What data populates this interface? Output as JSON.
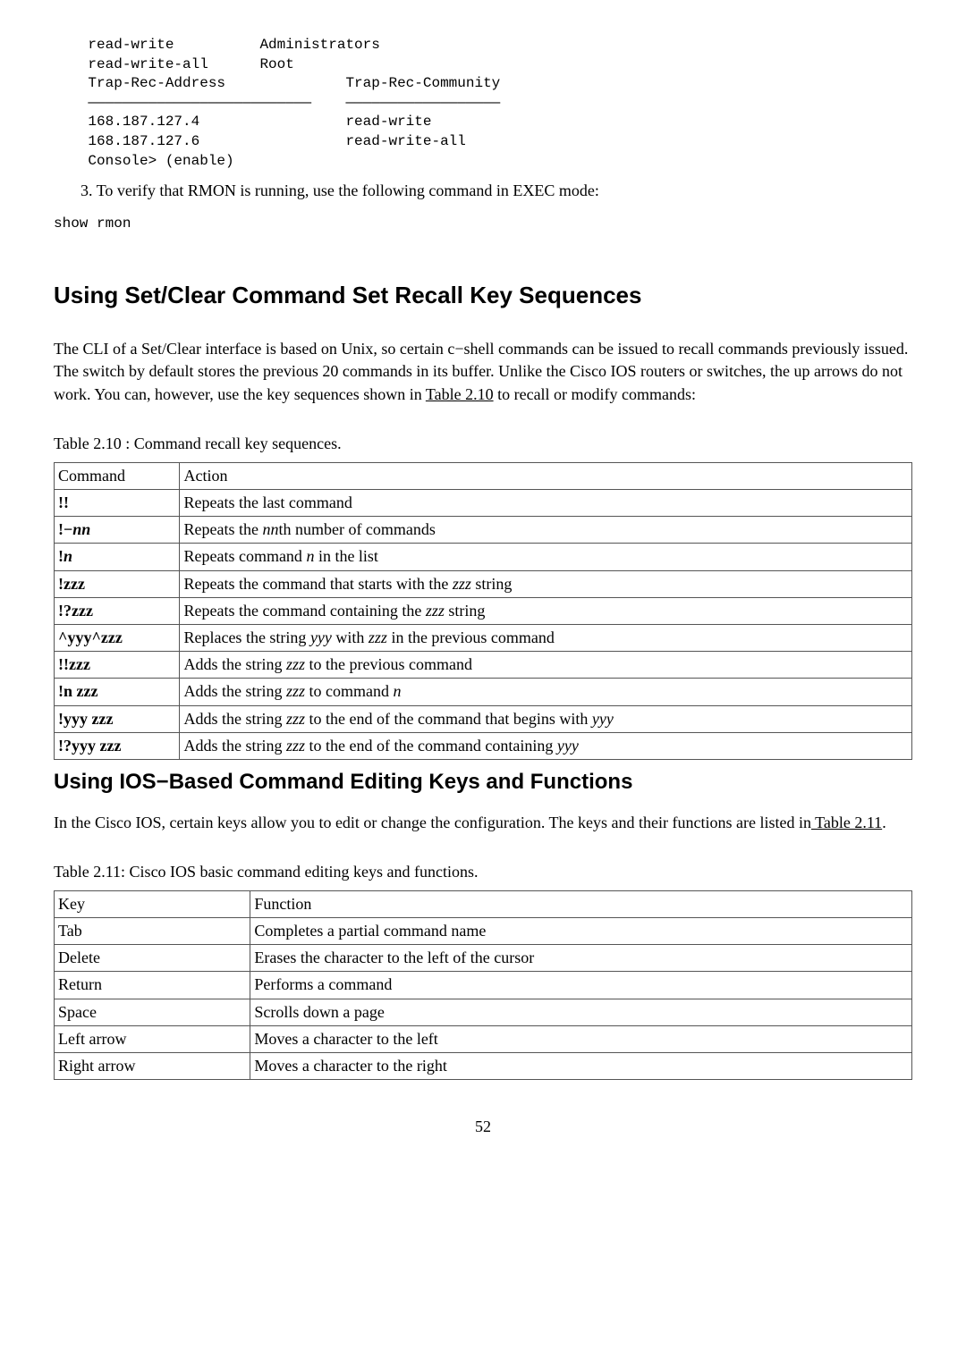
{
  "code_block_top": "    read-write          Administrators\n    read-write-all      Root\n    Trap-Rec-Address              Trap-Rec-Community\n    ——————————————————————————    ——————————————————\n    168.187.127.4                 read-write\n    168.187.127.6                 read-write-all\n    Console> (enable)",
  "list_item_3": "To verify that RMON is running, use the following command in EXEC mode:",
  "code_inline_show": "show rmon",
  "section1_title": "Using Set/Clear Command Set Recall Key Sequences",
  "section1_para_before": "The CLI of a Set/Clear interface is based on Unix, so certain c−shell commands can be issued to recall commands previously issued. The switch by default stores the previous 20 commands in its buffer. Unlike the Cisco IOS routers or switches, the up arrows do not work. You can, however, use the key sequences shown in ",
  "section1_para_link": "Table 2.10",
  "section1_para_after": " to recall or modify commands:",
  "table210_caption": "Table 2.10  : Command recall key sequences.",
  "table210": {
    "headers": [
      "Command",
      "Action"
    ],
    "rows": [
      {
        "cmd_plain": "!!",
        "action_plain": "Repeats the last command"
      },
      {
        "cmd_b": "!−",
        "cmd_bi": "nn",
        "action_before": "Repeats the ",
        "action_it": "nn",
        "action_after": "th number of commands"
      },
      {
        "cmd_b": "!",
        "cmd_bi": "n",
        "action_before": "Repeats command ",
        "action_it": "n",
        "action_after": " in the list"
      },
      {
        "cmd_plain": "!zzz",
        "action_before": "Repeats the command that starts with the ",
        "action_it": "zzz",
        "action_after": " string"
      },
      {
        "cmd_plain": "!?zzz",
        "action_before": "Repeats the command containing the ",
        "action_it": "zzz",
        "action_after": " string"
      },
      {
        "cmd_plain": "^yyy^zzz",
        "action_before": "Replaces the string ",
        "action_it": "yyy",
        "action_mid": " with ",
        "action_it2": "zzz",
        "action_after": " in the previous command"
      },
      {
        "cmd_plain": "!!zzz",
        "action_before": "Adds the string ",
        "action_it": "zzz",
        "action_after": " to the previous command"
      },
      {
        "cmd_plain": "!n zzz",
        "action_before": "Adds the string ",
        "action_it": "zzz",
        "action_mid": " to command ",
        "action_it2": "n",
        "action_after": ""
      },
      {
        "cmd_plain": "!yyy zzz",
        "action_before": "Adds the string ",
        "action_it": "zzz",
        "action_mid": " to the end of the command that begins with ",
        "action_it2": "yyy",
        "action_after": ""
      },
      {
        "cmd_plain": "!?yyy zzz",
        "action_before": "Adds the string ",
        "action_it": "zzz",
        "action_mid": " to the end of the command containing ",
        "action_it2": "yyy",
        "action_after": ""
      }
    ]
  },
  "section2_title": "Using IOS−Based Command Editing Keys and Functions",
  "section2_para_before": "In the Cisco IOS, certain keys allow you to edit or change the configuration. The keys and their functions are listed in",
  "section2_para_link": " Table 2.11",
  "section2_para_after": ".",
  "table211_caption": "Table 2.11: Cisco IOS basic command editing keys and functions.",
  "table211": {
    "headers": [
      "Key",
      "Function"
    ],
    "rows": [
      {
        "k": "Tab",
        "f": "Completes a partial command name"
      },
      {
        "k": "Delete",
        "f": "Erases the character to the left of the cursor"
      },
      {
        "k": "Return",
        "f": "Performs a command"
      },
      {
        "k": "Space",
        "f": "Scrolls down a page"
      },
      {
        "k": "Left arrow",
        "f": "Moves a character to the left"
      },
      {
        "k": "Right arrow",
        "f": "Moves a character to the right"
      }
    ]
  },
  "page_number": "52"
}
